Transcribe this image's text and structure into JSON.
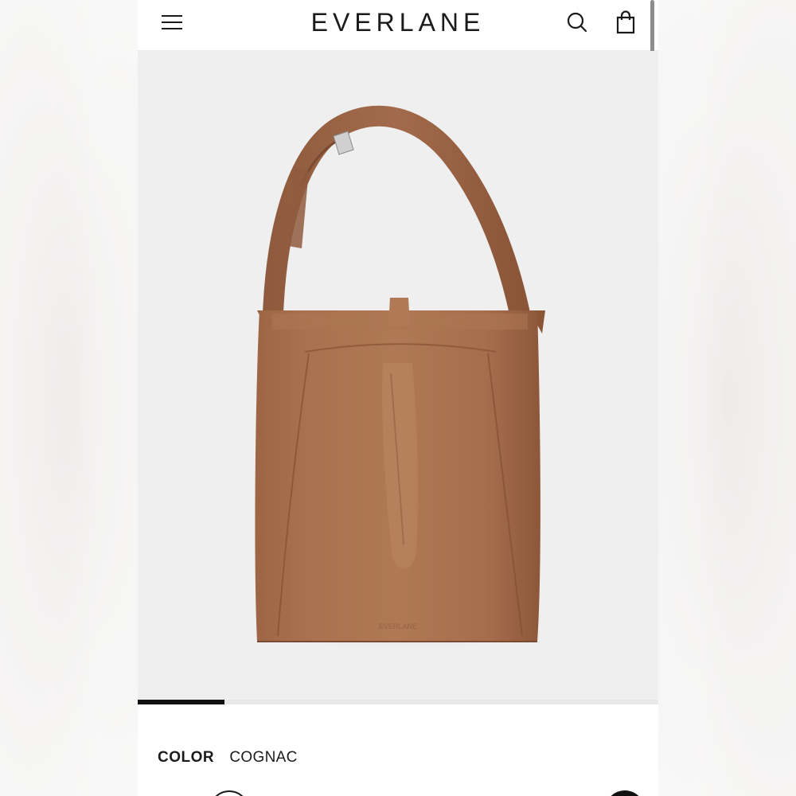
{
  "header": {
    "logo": "EVERLANE",
    "menu_icon": "menu-icon",
    "search_icon": "search-icon",
    "cart_icon": "shopping-bag-icon"
  },
  "product": {
    "image_label": "cognac leather tote bag",
    "carousel_progress": 0.167,
    "color_label": "COLOR",
    "color_value": "COGNAC",
    "swatches": [
      {
        "name": "cognac",
        "color": "#9b6447",
        "selected": true
      },
      {
        "name": "black",
        "color": "#111111",
        "selected": false
      }
    ]
  },
  "colors": {
    "leather": "#a8704f",
    "leather_dark": "#8a5435",
    "background": "#efefef"
  }
}
